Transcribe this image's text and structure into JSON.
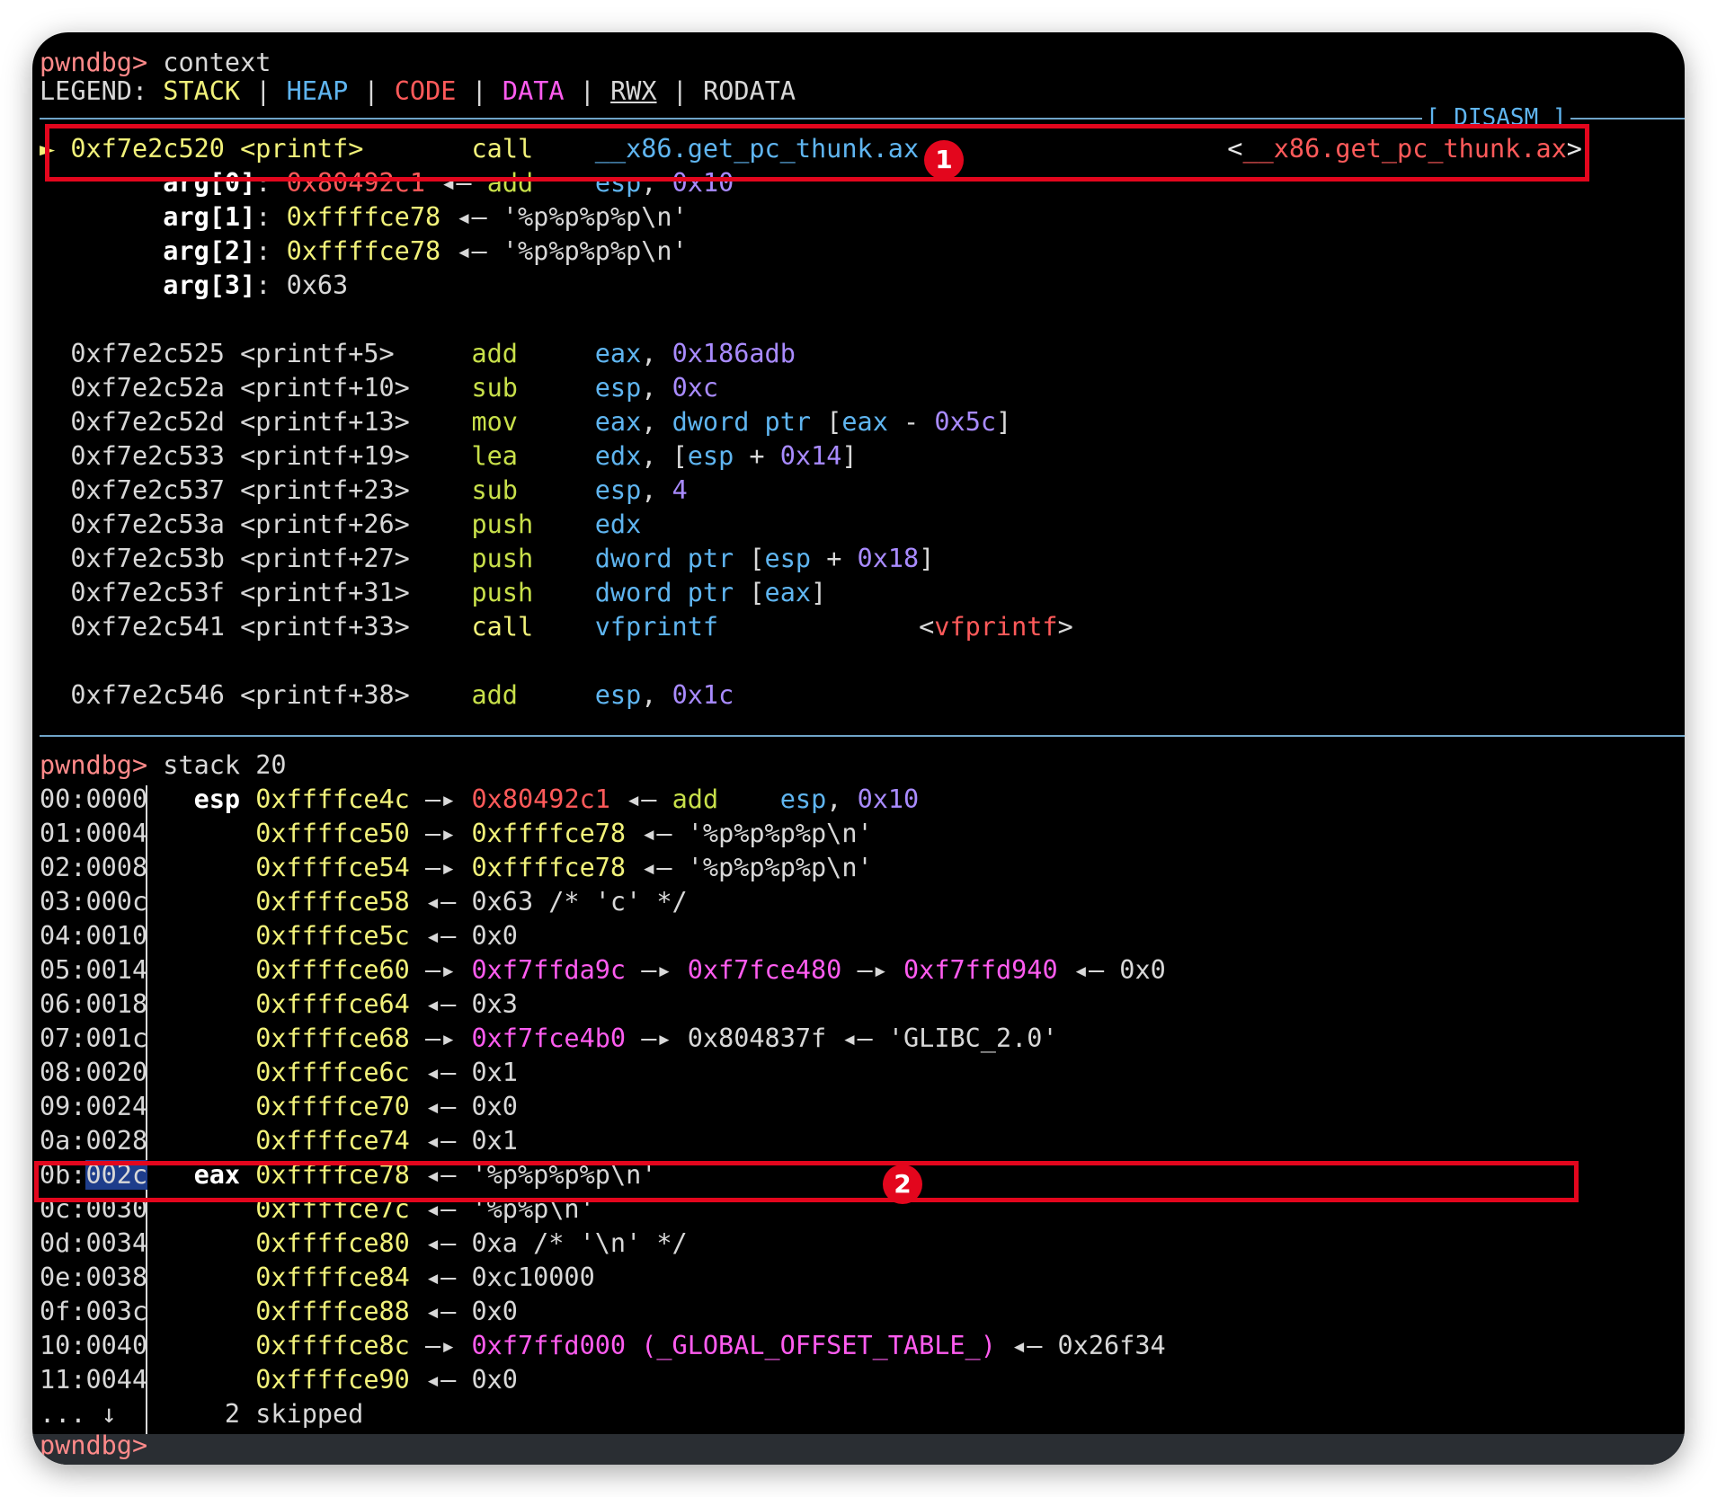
{
  "context": {
    "prompt": "pwndbg>",
    "command": "context"
  },
  "legend": {
    "label": "LEGEND:",
    "stack": "STACK",
    "heap": "HEAP",
    "code": "CODE",
    "data": "DATA",
    "rwx": "RWX",
    "rodata": "RODATA",
    "sep": "|"
  },
  "disasm_header": "[ DISASM ]",
  "current": {
    "marker": "►",
    "addr": "0xf7e2c520",
    "sym": "<printf>",
    "mnem": "call",
    "op": "__x86.get_pc_thunk.ax",
    "target": "<__x86.get_pc_thunk.ax>"
  },
  "args": [
    {
      "name": "arg[0]",
      "colon": ":",
      "val": "0x80492c1",
      "arrow": "◂—",
      "mnem": "add",
      "op1": "esp",
      "comma": ",",
      "op2": "0x10"
    },
    {
      "name": "arg[1]",
      "colon": ":",
      "val": "0xffffce78",
      "arrow": "◂—",
      "str": "'%p%p%p%p\\n'"
    },
    {
      "name": "arg[2]",
      "colon": ":",
      "val": "0xffffce78",
      "arrow": "◂—",
      "str": "'%p%p%p%p\\n'"
    },
    {
      "name": "arg[3]",
      "colon": ":",
      "val": "0x63"
    }
  ],
  "disasm": [
    {
      "addr": "0xf7e2c525",
      "sym": "<printf+5>",
      "mnem": "add",
      "reg": "eax",
      "comma": ",",
      "imm": "0x186adb"
    },
    {
      "addr": "0xf7e2c52a",
      "sym": "<printf+10>",
      "mnem": "sub",
      "reg": "esp",
      "comma": ",",
      "imm": "0xc"
    },
    {
      "addr": "0xf7e2c52d",
      "sym": "<printf+13>",
      "mnem": "mov",
      "reg": "eax",
      "comma": ",",
      "kw": "dword ptr",
      "lb": "[",
      "r2": "eax",
      "opr": "-",
      "imm": "0x5c",
      "rb": "]"
    },
    {
      "addr": "0xf7e2c533",
      "sym": "<printf+19>",
      "mnem": "lea",
      "reg": "edx",
      "comma": ",",
      "lb": "[",
      "r2": "esp",
      "opr": "+",
      "imm": "0x14",
      "rb": "]"
    },
    {
      "addr": "0xf7e2c537",
      "sym": "<printf+23>",
      "mnem": "sub",
      "reg": "esp",
      "comma": ",",
      "imm": "4"
    },
    {
      "addr": "0xf7e2c53a",
      "sym": "<printf+26>",
      "mnem": "push",
      "reg": "edx"
    },
    {
      "addr": "0xf7e2c53b",
      "sym": "<printf+27>",
      "mnem": "push",
      "kw": "dword ptr",
      "lb": "[",
      "r2": "esp",
      "opr": "+",
      "imm": "0x18",
      "rb": "]"
    },
    {
      "addr": "0xf7e2c53f",
      "sym": "<printf+31>",
      "mnem": "push",
      "kw": "dword ptr",
      "lb": "[",
      "r2": "eax",
      "rb": "]"
    },
    {
      "addr": "0xf7e2c541",
      "sym": "<printf+33>",
      "mnem": "call",
      "reg": "vfprintf",
      "target": "<vfprintf>"
    },
    {
      "addr": "0xf7e2c546",
      "sym": "<printf+38>",
      "mnem": "add",
      "reg": "esp",
      "comma": ",",
      "imm": "0x1c"
    }
  ],
  "stack": {
    "prompt": "pwndbg>",
    "command": "stack 20",
    "rows": [
      {
        "idx": "00:0000",
        "reg": "esp",
        "addr": "0xffffce4c",
        "a1": "—▸",
        "v1": "0x80492c1",
        "a2": "◂—",
        "mnem": "add",
        "r": "esp",
        "comma": ",",
        "imm": "0x10"
      },
      {
        "idx": "01:0004",
        "addr": "0xffffce50",
        "a1": "—▸",
        "v1": "0xffffce78",
        "a2": "◂—",
        "str": "'%p%p%p%p\\n'"
      },
      {
        "idx": "02:0008",
        "addr": "0xffffce54",
        "a1": "—▸",
        "v1": "0xffffce78",
        "a2": "◂—",
        "str": "'%p%p%p%p\\n'"
      },
      {
        "idx": "03:000c",
        "addr": "0xffffce58",
        "a1": "◂—",
        "w1": "0x63 /* 'c' */"
      },
      {
        "idx": "04:0010",
        "addr": "0xffffce5c",
        "a1": "◂—",
        "w1": "0x0"
      },
      {
        "idx": "05:0014",
        "addr": "0xffffce60",
        "a1": "—▸",
        "v1": "0xf7ffda9c",
        "a2": "—▸",
        "v2": "0xf7fce480",
        "a3": "—▸",
        "v3": "0xf7ffd940",
        "a4": "◂—",
        "w4": "0x0"
      },
      {
        "idx": "06:0018",
        "addr": "0xffffce64",
        "a1": "◂—",
        "w1": "0x3"
      },
      {
        "idx": "07:001c",
        "addr": "0xffffce68",
        "a1": "—▸",
        "v1": "0xf7fce4b0",
        "a2": "—▸",
        "w2": "0x804837f",
        "a3": "◂—",
        "str": "'GLIBC_2.0'"
      },
      {
        "idx": "08:0020",
        "addr": "0xffffce6c",
        "a1": "◂—",
        "w1": "0x1"
      },
      {
        "idx": "09:0024",
        "addr": "0xffffce70",
        "a1": "◂—",
        "w1": "0x0"
      },
      {
        "idx": "0a:0028",
        "addr": "0xffffce74",
        "a1": "◂—",
        "w1": "0x1"
      },
      {
        "idx_a": "0b:",
        "idx_b": "002c",
        "reg": "eax",
        "addr": "0xffffce78",
        "a1": "◂—",
        "str": "'%p%p%p%p\\n'"
      },
      {
        "idx": "0c:0030",
        "addr": "0xffffce7c",
        "a1": "◂—",
        "str": "'%p%p\\n'"
      },
      {
        "idx": "0d:0034",
        "addr": "0xffffce80",
        "a1": "◂—",
        "w1": "0xa /* '\\n' */"
      },
      {
        "idx": "0e:0038",
        "addr": "0xffffce84",
        "a1": "◂—",
        "w1": "0xc10000"
      },
      {
        "idx": "0f:003c",
        "addr": "0xffffce88",
        "a1": "◂—",
        "w1": "0x0"
      },
      {
        "idx": "10:0040",
        "addr": "0xffffce8c",
        "a1": "—▸",
        "v1": "0xf7ffd000 (_GLOBAL_OFFSET_TABLE_)",
        "a2": "◂—",
        "w2": "0x26f34"
      },
      {
        "idx": "11:0044",
        "addr": "0xffffce90",
        "a1": "◂—",
        "w1": "0x0"
      }
    ],
    "skipped_dots": "... ↓",
    "skipped_text": "2 skipped"
  },
  "final_prompt": "pwndbg>",
  "badges": [
    "1",
    "2"
  ],
  "colors": {
    "background": "#000000",
    "prompt": "#ff8a8a",
    "address": "#f2f27a",
    "mnemonic": "#c8e04a",
    "register": "#5fb5f0",
    "immediate": "#a98bff",
    "code": "#ff5a5a",
    "data": "#ff5cf0",
    "highlight": "#e3061d"
  }
}
